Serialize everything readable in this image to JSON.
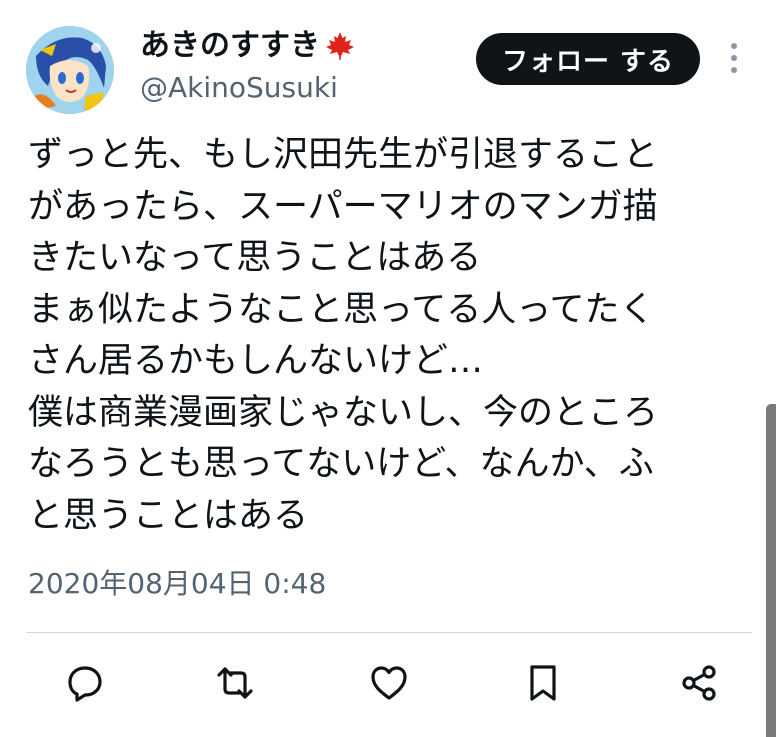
{
  "user": {
    "display_name": "あきのすすき",
    "handle": "@AkinoSusuki",
    "badge_icon": "maple-leaf-icon"
  },
  "follow_button": {
    "label": "フォロー する"
  },
  "tweet": {
    "text": "ずっと先、もし沢田先生が引退すること\nがあったら、スーパーマリオのマンガ描\nきたいなって思うことはある\nまぁ似たようなこと思ってる人ってたく\nさん居るかもしんないけど…\n僕は商業漫画家じゃないし、今のところ\nなろうとも思ってないけど、なんか、ふ\nと思うことはある",
    "timestamp": "2020年08月04日 0:48"
  },
  "actions": [
    {
      "name": "reply-icon"
    },
    {
      "name": "retweet-icon"
    },
    {
      "name": "like-icon"
    },
    {
      "name": "bookmark-icon"
    },
    {
      "name": "share-icon"
    }
  ],
  "colors": {
    "text": "#0f1419",
    "secondary": "#536471",
    "button_bg": "#0f1419",
    "button_text": "#ffffff",
    "divider": "#cfd9de",
    "maple_leaf": "#e0241b"
  }
}
